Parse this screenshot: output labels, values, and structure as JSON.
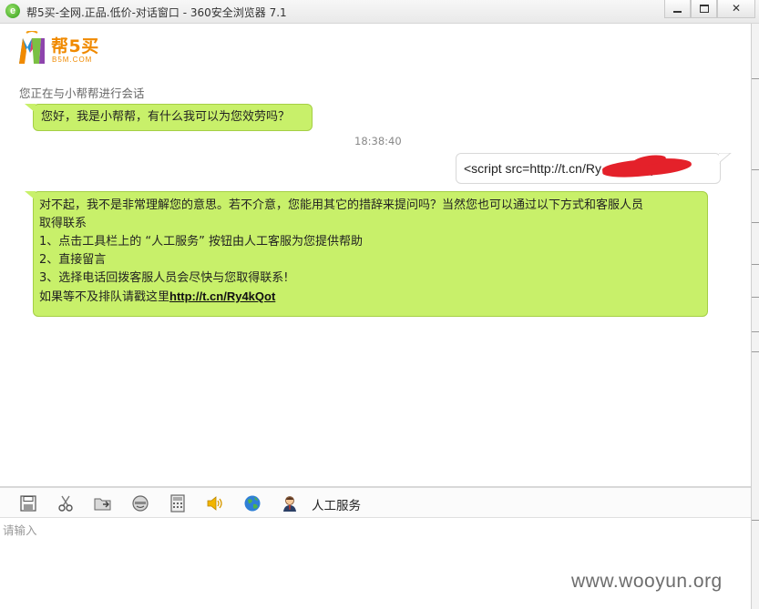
{
  "window": {
    "title": "帮5买-全网.正品.低价-对话窗口 - 360安全浏览器 7.1"
  },
  "logo": {
    "text": "帮5买",
    "subtext": "B5M.COM"
  },
  "chat": {
    "status": "您正在与小帮帮进行会话",
    "messages": [
      {
        "from": "bot",
        "text": "您好，我是小帮帮，有什么我可以为您效劳吗？"
      },
      {
        "timestamp": "18:38:40"
      },
      {
        "from": "user",
        "text": "<script src=http://t.cn/Ry…  …script>"
      },
      {
        "from": "bot",
        "lines": [
          "对不起，我不是非常理解您的意思。若不介意，您能用其它的措辞来提问吗？当然您也可以通过以下方式和客服人员",
          "取得联系",
          "1、点击工具栏上的 “人工服务” 按钮由人工客服为您提供帮助",
          "2、直接留言",
          "3、选择电话回拨客服人员会尽快与您取得联系!"
        ],
        "link_prefix": "如果等不及排队请戳这里",
        "link_text": "http://t.cn/Ry4kQot"
      }
    ]
  },
  "toolbar": {
    "icons": [
      "save-icon",
      "scissors-icon",
      "folder-send-icon",
      "emoticon-icon",
      "calculator-icon",
      "speaker-icon",
      "globe-icon",
      "agent-icon"
    ],
    "service_label": "人工服务"
  },
  "input": {
    "placeholder": "请输入"
  },
  "watermark": "www.wooyun.org",
  "colors": {
    "bot_bubble": "#c8f06a",
    "logo_orange": "#f08a00",
    "redaction": "#e4212a"
  }
}
